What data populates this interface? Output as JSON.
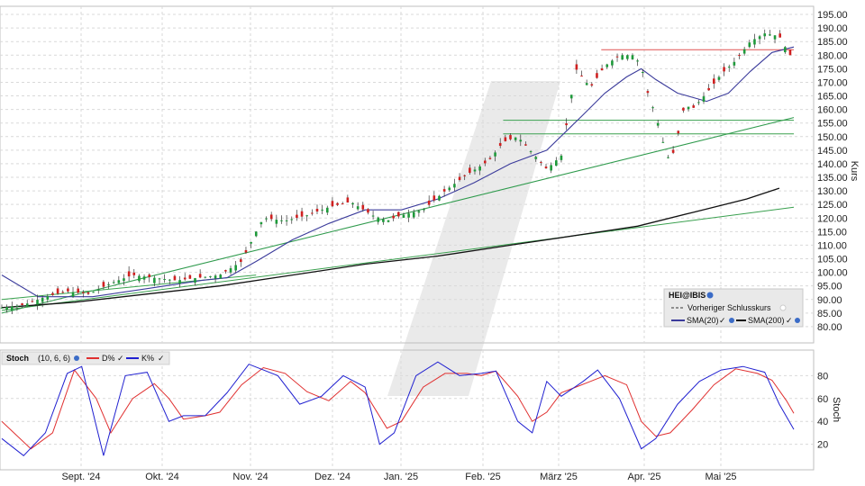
{
  "chart_data": [
    {
      "type": "candlestick",
      "ylabel": "Kurs",
      "ylim": [
        75,
        197
      ],
      "yticks": [
        80,
        85,
        90,
        95,
        100,
        105,
        110,
        115,
        120,
        125,
        130,
        135,
        140,
        145,
        150,
        155,
        160,
        165,
        170,
        175,
        180,
        185,
        190,
        195
      ],
      "x_labels": [
        "Sept. '24",
        "Okt. '24",
        "Nov. '24",
        "Dez. '24",
        "Jan. '25",
        "Feb. '25",
        "März '25",
        "Apr. '25",
        "Mai '25"
      ],
      "grid": true,
      "legend_position": "bottom-right",
      "legend": {
        "symbol": "HEI@IBIS",
        "prev_close_label": "Vorheriger Schlusskurs",
        "sma20_label": "SMA(20)",
        "sma200_label": "SMA(200)"
      },
      "candle_close_anchors": [
        [
          0,
          87
        ],
        [
          6,
          88
        ],
        [
          12,
          91
        ],
        [
          18,
          93
        ],
        [
          24,
          92
        ],
        [
          30,
          96
        ],
        [
          36,
          99
        ],
        [
          42,
          98
        ],
        [
          48,
          97
        ],
        [
          54,
          98
        ],
        [
          60,
          99
        ],
        [
          66,
          104
        ],
        [
          70,
          115
        ],
        [
          72,
          120
        ],
        [
          78,
          119
        ],
        [
          84,
          121
        ],
        [
          90,
          124
        ],
        [
          96,
          126
        ],
        [
          102,
          121
        ],
        [
          106,
          119
        ],
        [
          110,
          121
        ],
        [
          116,
          123
        ],
        [
          122,
          130
        ],
        [
          128,
          136
        ],
        [
          134,
          141
        ],
        [
          138,
          148
        ],
        [
          142,
          150
        ],
        [
          146,
          144
        ],
        [
          150,
          138
        ],
        [
          154,
          143
        ],
        [
          158,
          175
        ],
        [
          162,
          168
        ],
        [
          166,
          176
        ],
        [
          170,
          180
        ],
        [
          174,
          180
        ],
        [
          176,
          176
        ],
        [
          178,
          165
        ],
        [
          180,
          158
        ],
        [
          182,
          148
        ],
        [
          184,
          140
        ],
        [
          186,
          150
        ],
        [
          188,
          162
        ],
        [
          190,
          160
        ],
        [
          194,
          166
        ],
        [
          198,
          173
        ],
        [
          202,
          178
        ],
        [
          206,
          185
        ],
        [
          210,
          188
        ],
        [
          214,
          187
        ],
        [
          216,
          182
        ],
        [
          218,
          178
        ]
      ],
      "series": [
        {
          "name": "SMA(20)",
          "color": "#3b3b9b",
          "points": [
            [
              0,
              99
            ],
            [
              10,
              91
            ],
            [
              25,
              91
            ],
            [
              40,
              94
            ],
            [
              55,
              97
            ],
            [
              62,
              98
            ],
            [
              70,
              104
            ],
            [
              80,
              112
            ],
            [
              90,
              118
            ],
            [
              100,
              123
            ],
            [
              110,
              123
            ],
            [
              120,
              127
            ],
            [
              130,
              133
            ],
            [
              140,
              140
            ],
            [
              150,
              145
            ],
            [
              160,
              158
            ],
            [
              166,
              166
            ],
            [
              172,
              172
            ],
            [
              176,
              175
            ],
            [
              180,
              171
            ],
            [
              186,
              166
            ],
            [
              194,
              163
            ],
            [
              200,
              166
            ],
            [
              206,
              174
            ],
            [
              212,
              181
            ],
            [
              218,
              183
            ]
          ]
        },
        {
          "name": "SMA(200)",
          "color": "#111111",
          "points": [
            [
              0,
              87
            ],
            [
              20,
              89
            ],
            [
              40,
              92
            ],
            [
              60,
              95
            ],
            [
              80,
              99
            ],
            [
              100,
              103
            ],
            [
              120,
              106
            ],
            [
              140,
              110
            ],
            [
              160,
              114
            ],
            [
              175,
              117
            ],
            [
              190,
              122
            ],
            [
              205,
              127
            ],
            [
              214,
              131
            ]
          ]
        }
      ],
      "trendlines": [
        {
          "color": "#2e9a4c",
          "from": [
            0,
            85
          ],
          "to": [
            218,
            157
          ]
        },
        {
          "color": "#3aa04f",
          "from": [
            0,
            86
          ],
          "to": [
            218,
            124
          ]
        },
        {
          "color": "#39a34f",
          "from": [
            0,
            90
          ],
          "to": [
            70,
            99
          ]
        }
      ],
      "horizontal_lines": [
        {
          "color": "#e05050",
          "value": 182,
          "from": 165,
          "to": 218
        },
        {
          "color": "#3aa04f",
          "value": 156,
          "from": 138,
          "to": 218
        },
        {
          "color": "#3aa04f",
          "value": 151,
          "from": 138,
          "to": 218
        }
      ]
    },
    {
      "type": "line",
      "title": "Stoch",
      "params": "(10, 6, 6)",
      "ylabel": "Stoch",
      "ylim": [
        0,
        100
      ],
      "yticks": [
        20,
        40,
        60,
        80
      ],
      "legend": {
        "d_label": "D%",
        "k_label": "K%"
      },
      "series": [
        {
          "name": "D%",
          "color": "#e03030",
          "points": [
            [
              0,
              40
            ],
            [
              8,
              16
            ],
            [
              14,
              30
            ],
            [
              20,
              85
            ],
            [
              26,
              60
            ],
            [
              30,
              30
            ],
            [
              36,
              60
            ],
            [
              42,
              73
            ],
            [
              46,
              60
            ],
            [
              50,
              42
            ],
            [
              56,
              45
            ],
            [
              60,
              48
            ],
            [
              66,
              72
            ],
            [
              72,
              87
            ],
            [
              78,
              82
            ],
            [
              84,
              66
            ],
            [
              90,
              58
            ],
            [
              96,
              75
            ],
            [
              100,
              65
            ],
            [
              106,
              34
            ],
            [
              110,
              40
            ],
            [
              116,
              70
            ],
            [
              122,
              82
            ],
            [
              128,
              82
            ],
            [
              132,
              80
            ],
            [
              136,
              84
            ],
            [
              142,
              62
            ],
            [
              146,
              40
            ],
            [
              150,
              48
            ],
            [
              154,
              65
            ],
            [
              158,
              70
            ],
            [
              162,
              75
            ],
            [
              166,
              80
            ],
            [
              172,
              72
            ],
            [
              176,
              40
            ],
            [
              180,
              27
            ],
            [
              184,
              30
            ],
            [
              190,
              50
            ],
            [
              196,
              72
            ],
            [
              202,
              86
            ],
            [
              208,
              82
            ],
            [
              212,
              76
            ],
            [
              216,
              58
            ],
            [
              218,
              47
            ]
          ]
        },
        {
          "name": "K%",
          "color": "#2020d0",
          "points": [
            [
              0,
              25
            ],
            [
              6,
              10
            ],
            [
              12,
              30
            ],
            [
              18,
              82
            ],
            [
              22,
              88
            ],
            [
              28,
              10
            ],
            [
              34,
              80
            ],
            [
              40,
              83
            ],
            [
              46,
              40
            ],
            [
              50,
              45
            ],
            [
              56,
              45
            ],
            [
              62,
              65
            ],
            [
              68,
              90
            ],
            [
              76,
              80
            ],
            [
              82,
              55
            ],
            [
              88,
              62
            ],
            [
              94,
              80
            ],
            [
              100,
              70
            ],
            [
              104,
              20
            ],
            [
              108,
              30
            ],
            [
              114,
              80
            ],
            [
              120,
              92
            ],
            [
              126,
              80
            ],
            [
              132,
              82
            ],
            [
              136,
              84
            ],
            [
              142,
              40
            ],
            [
              146,
              30
            ],
            [
              150,
              75
            ],
            [
              154,
              62
            ],
            [
              160,
              75
            ],
            [
              164,
              85
            ],
            [
              170,
              60
            ],
            [
              176,
              16
            ],
            [
              180,
              25
            ],
            [
              186,
              55
            ],
            [
              192,
              75
            ],
            [
              198,
              85
            ],
            [
              204,
              88
            ],
            [
              210,
              83
            ],
            [
              214,
              55
            ],
            [
              218,
              33
            ]
          ]
        }
      ]
    }
  ]
}
